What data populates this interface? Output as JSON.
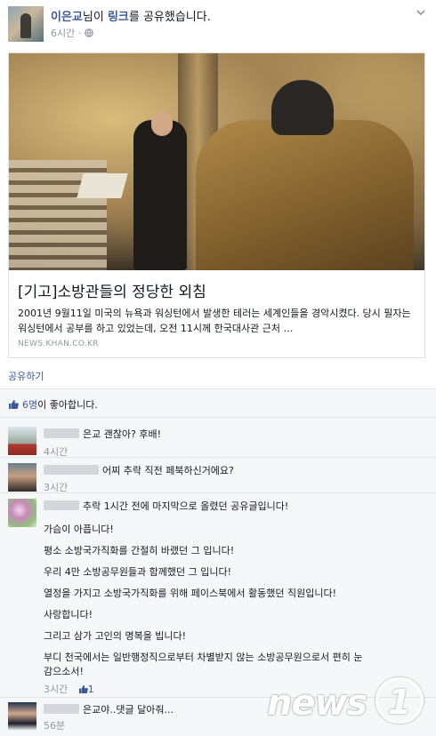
{
  "header": {
    "author": "이은교",
    "action_pre": "님이 ",
    "action_link": "링크",
    "action_post": "를 공유했습니다.",
    "time": "6시간",
    "privacy_icon": "globe-icon",
    "menu_icon": "chevron-down-icon"
  },
  "link_card": {
    "title": "[기고]소방관들의 정당한 외침",
    "description": "2001년 9월11일 미국의 뉴욕과 워싱턴에서 발생한 테러는 세계인들을 경악시켰다. 당시 필자는 워싱턴에서 공부를 하고 있었는데, 오전 11시께 한국대사관 근처 …",
    "source": "NEWS.KHAN.CO.KR"
  },
  "share_label": "공유하기",
  "likes": {
    "count": "6명",
    "suffix": "이 좋아합니다."
  },
  "comments": [
    {
      "text": "은교 괜찮아? 후배!",
      "time": "4시간"
    },
    {
      "text": "어찌 추락 직전 페북하신거에요?",
      "time": "3시간"
    },
    {
      "lines": [
        "추락 1시간 전에 마지막으로 올렸던 공유글입니다!",
        "가슴이 아픕니다!",
        "평소 소방국가직화를 간절히 바랬던 그 입니다!",
        "우리 4만 소방공무원들과 함께했던 그 입니다!",
        "열정을 가지고 소방국가직화를 위해 페이스북에서 활동했던 직원입니다!",
        "사랑합니다!",
        "그리고 삼가 고인의 명복을 빕니다!",
        "부디 천국에서는 일반행정직으로부터 차별받지 않는 소방공무원으로서 편히 눈",
        "감으소서!"
      ],
      "time": "3시간",
      "like_count": "1"
    },
    {
      "text": "은교야..댓글 달아줘...",
      "time": "56분"
    }
  ],
  "watermark": {
    "text": "news",
    "number": "1"
  },
  "colors": {
    "link": "#3b5998",
    "meta": "#9197a3",
    "feedback_bg": "#f6f7f9"
  }
}
